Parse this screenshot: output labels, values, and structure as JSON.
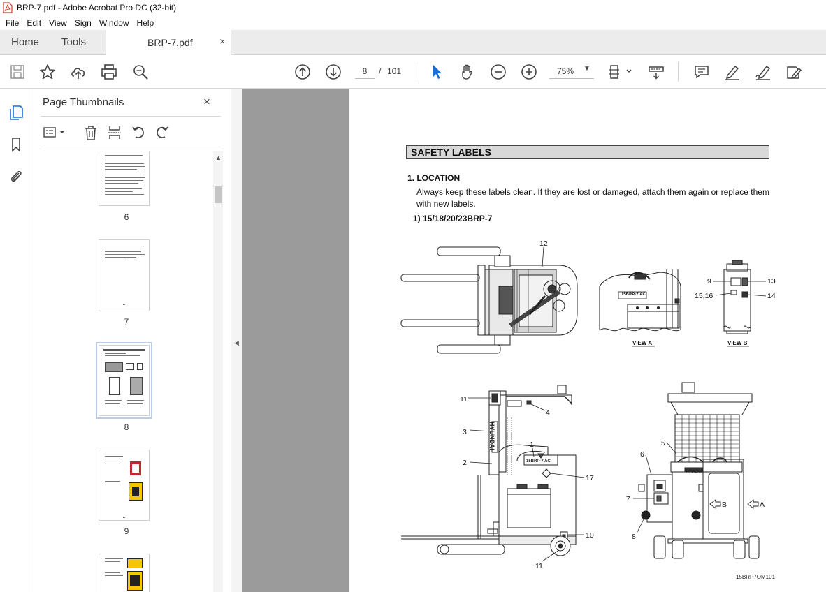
{
  "window": {
    "title": "BRP-7.pdf - Adobe Acrobat Pro DC (32-bit)"
  },
  "menu": [
    "File",
    "Edit",
    "View",
    "Sign",
    "Window",
    "Help"
  ],
  "tabs": {
    "home": "Home",
    "tools": "Tools",
    "document": "BRP-7.pdf",
    "close": "×"
  },
  "toolbar": {
    "current_page": "8",
    "page_separator": "/",
    "total_pages": "101",
    "zoom": "75%",
    "icons": [
      "save-icon",
      "star-icon",
      "upload-icon",
      "print-icon",
      "zoom-search-icon",
      "page-up-icon",
      "page-down-icon",
      "select-arrow-icon",
      "hand-icon",
      "zoom-out-icon",
      "zoom-in-icon",
      "fit-page-icon",
      "scroll-mode-icon",
      "comment-icon",
      "highlight-icon",
      "sign-icon",
      "fill-sign-icon"
    ]
  },
  "panel": {
    "title": "Page Thumbnails",
    "close": "×",
    "thumbnails": [
      {
        "page": "6",
        "selected": false
      },
      {
        "page": "7",
        "selected": false
      },
      {
        "page": "8",
        "selected": true
      },
      {
        "page": "9",
        "selected": false
      }
    ]
  },
  "page": {
    "section_title": "SAFETY LABELS",
    "heading": "1. LOCATION",
    "body": "Always keep these labels clean.  If they are lost or damaged, attach them again or replace them with new labels.",
    "model_heading": "1) 15/18/20/23BRP-7",
    "figure_labels": {
      "top_view": [
        "12"
      ],
      "view_a_caption": "VIEW A",
      "view_b_caption": "VIEW B",
      "view_b": [
        "9",
        "13",
        "15,16",
        "14"
      ],
      "side_view": [
        "11",
        "4",
        "3",
        "1",
        "2",
        "17",
        "10",
        "11"
      ],
      "rear_view": [
        "5",
        "6",
        "7",
        "8",
        "B",
        "A"
      ],
      "brand_text": "HYUNDAI",
      "model_badge": "15BRP-7 AC"
    },
    "figure_ref": "15BRP7OM101"
  }
}
